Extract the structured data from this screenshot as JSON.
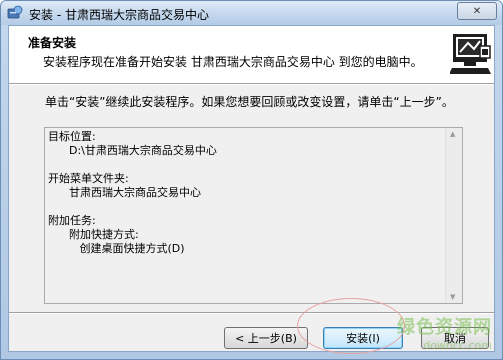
{
  "window": {
    "title": "安装 - 甘肃西瑞大宗商品交易中心",
    "close_glyph": "✕"
  },
  "header": {
    "title": "准备安装",
    "subtitle": "安装程序现在准备开始安装 甘肃西瑞大宗商品交易中心 到您的电脑中。",
    "graphic_icon": "computer-setup-icon"
  },
  "instruction": "单击“安装”继续此安装程序。如果您想要回顾或改变设置，请单击“上一步”。",
  "memo": {
    "text": "目标位置:\n      D:\\甘肃西瑞大宗商品交易中心\n\n开始菜单文件夹:\n      甘肃西瑞大宗商品交易中心\n\n附加任务:\n      附加快捷方式:\n         创建桌面快捷方式(D)"
  },
  "buttons": {
    "back": "< 上一步(B)",
    "install": "安装(I)",
    "cancel": "取消"
  },
  "watermark": {
    "main": "绿色资源网",
    "sub": "downcc.com"
  },
  "colors": {
    "frame": "#c4d8ee",
    "default_button_border": "#3c7fb1",
    "annotation": "#e8a0a0",
    "watermark": "#78be50"
  }
}
